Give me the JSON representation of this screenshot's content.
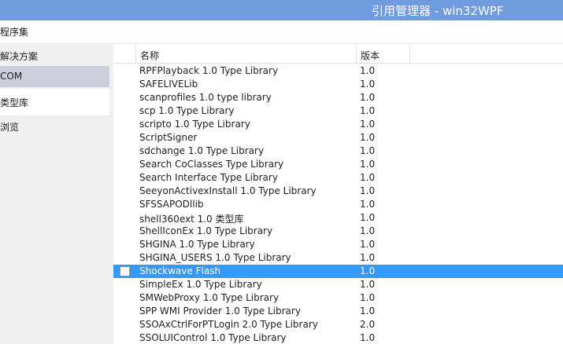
{
  "window": {
    "title": "引用管理器 - win32WPF"
  },
  "menubar": {
    "crumb": "程序集"
  },
  "sidebar": {
    "solution": "解决方案",
    "com": "COM",
    "typelib": "类型库",
    "browse": "浏览"
  },
  "columns": {
    "name": "名称",
    "version": "版本"
  },
  "rows": [
    {
      "name": "RPFPlayback 1.0 Type Library",
      "version": "1.0"
    },
    {
      "name": "SAFELIVELib",
      "version": "1.0"
    },
    {
      "name": "scanprofiles 1.0 type library",
      "version": "1.0"
    },
    {
      "name": "scp 1.0 Type Library",
      "version": "1.0"
    },
    {
      "name": "scripto 1.0 Type Library",
      "version": "1.0"
    },
    {
      "name": "ScriptSigner",
      "version": "1.0"
    },
    {
      "name": "sdchange 1.0 Type Library",
      "version": "1.0"
    },
    {
      "name": "Search CoClasses Type Library",
      "version": "1.0"
    },
    {
      "name": "Search Interface Type Library",
      "version": "1.0"
    },
    {
      "name": "SeeyonActivexInstall 1.0 Type Library",
      "version": "1.0"
    },
    {
      "name": "SFSSAPODllib",
      "version": "1.0"
    },
    {
      "name": "shell360ext 1.0 类型库",
      "version": "1.0"
    },
    {
      "name": "ShellIconEx 1.0 Type Library",
      "version": "1.0"
    },
    {
      "name": "SHGINA 1.0 Type Library",
      "version": "1.0"
    },
    {
      "name": "SHGINA_USERS 1.0 Type Library",
      "version": "1.0"
    },
    {
      "name": "Shockwave Flash",
      "version": "1.0",
      "selected": true
    },
    {
      "name": "SimpleEx 1.0 Type Library",
      "version": "1.0"
    },
    {
      "name": "SMWebProxy 1.0 Type Library",
      "version": "1.0"
    },
    {
      "name": "SPP WMI Provider 1.0 Type Library",
      "version": "1.0"
    },
    {
      "name": "SSOAxCtrlForPTLogin 2.0 Type Library",
      "version": "2.0"
    },
    {
      "name": "SSOLUIControl 1.0 Type Library",
      "version": "1.0"
    }
  ],
  "colors": {
    "titlebar": "#6f9bdf",
    "selection": "#3399ff",
    "sidebar_selected": "#cccedb",
    "sidebar_bg": "#f0f0f0"
  }
}
